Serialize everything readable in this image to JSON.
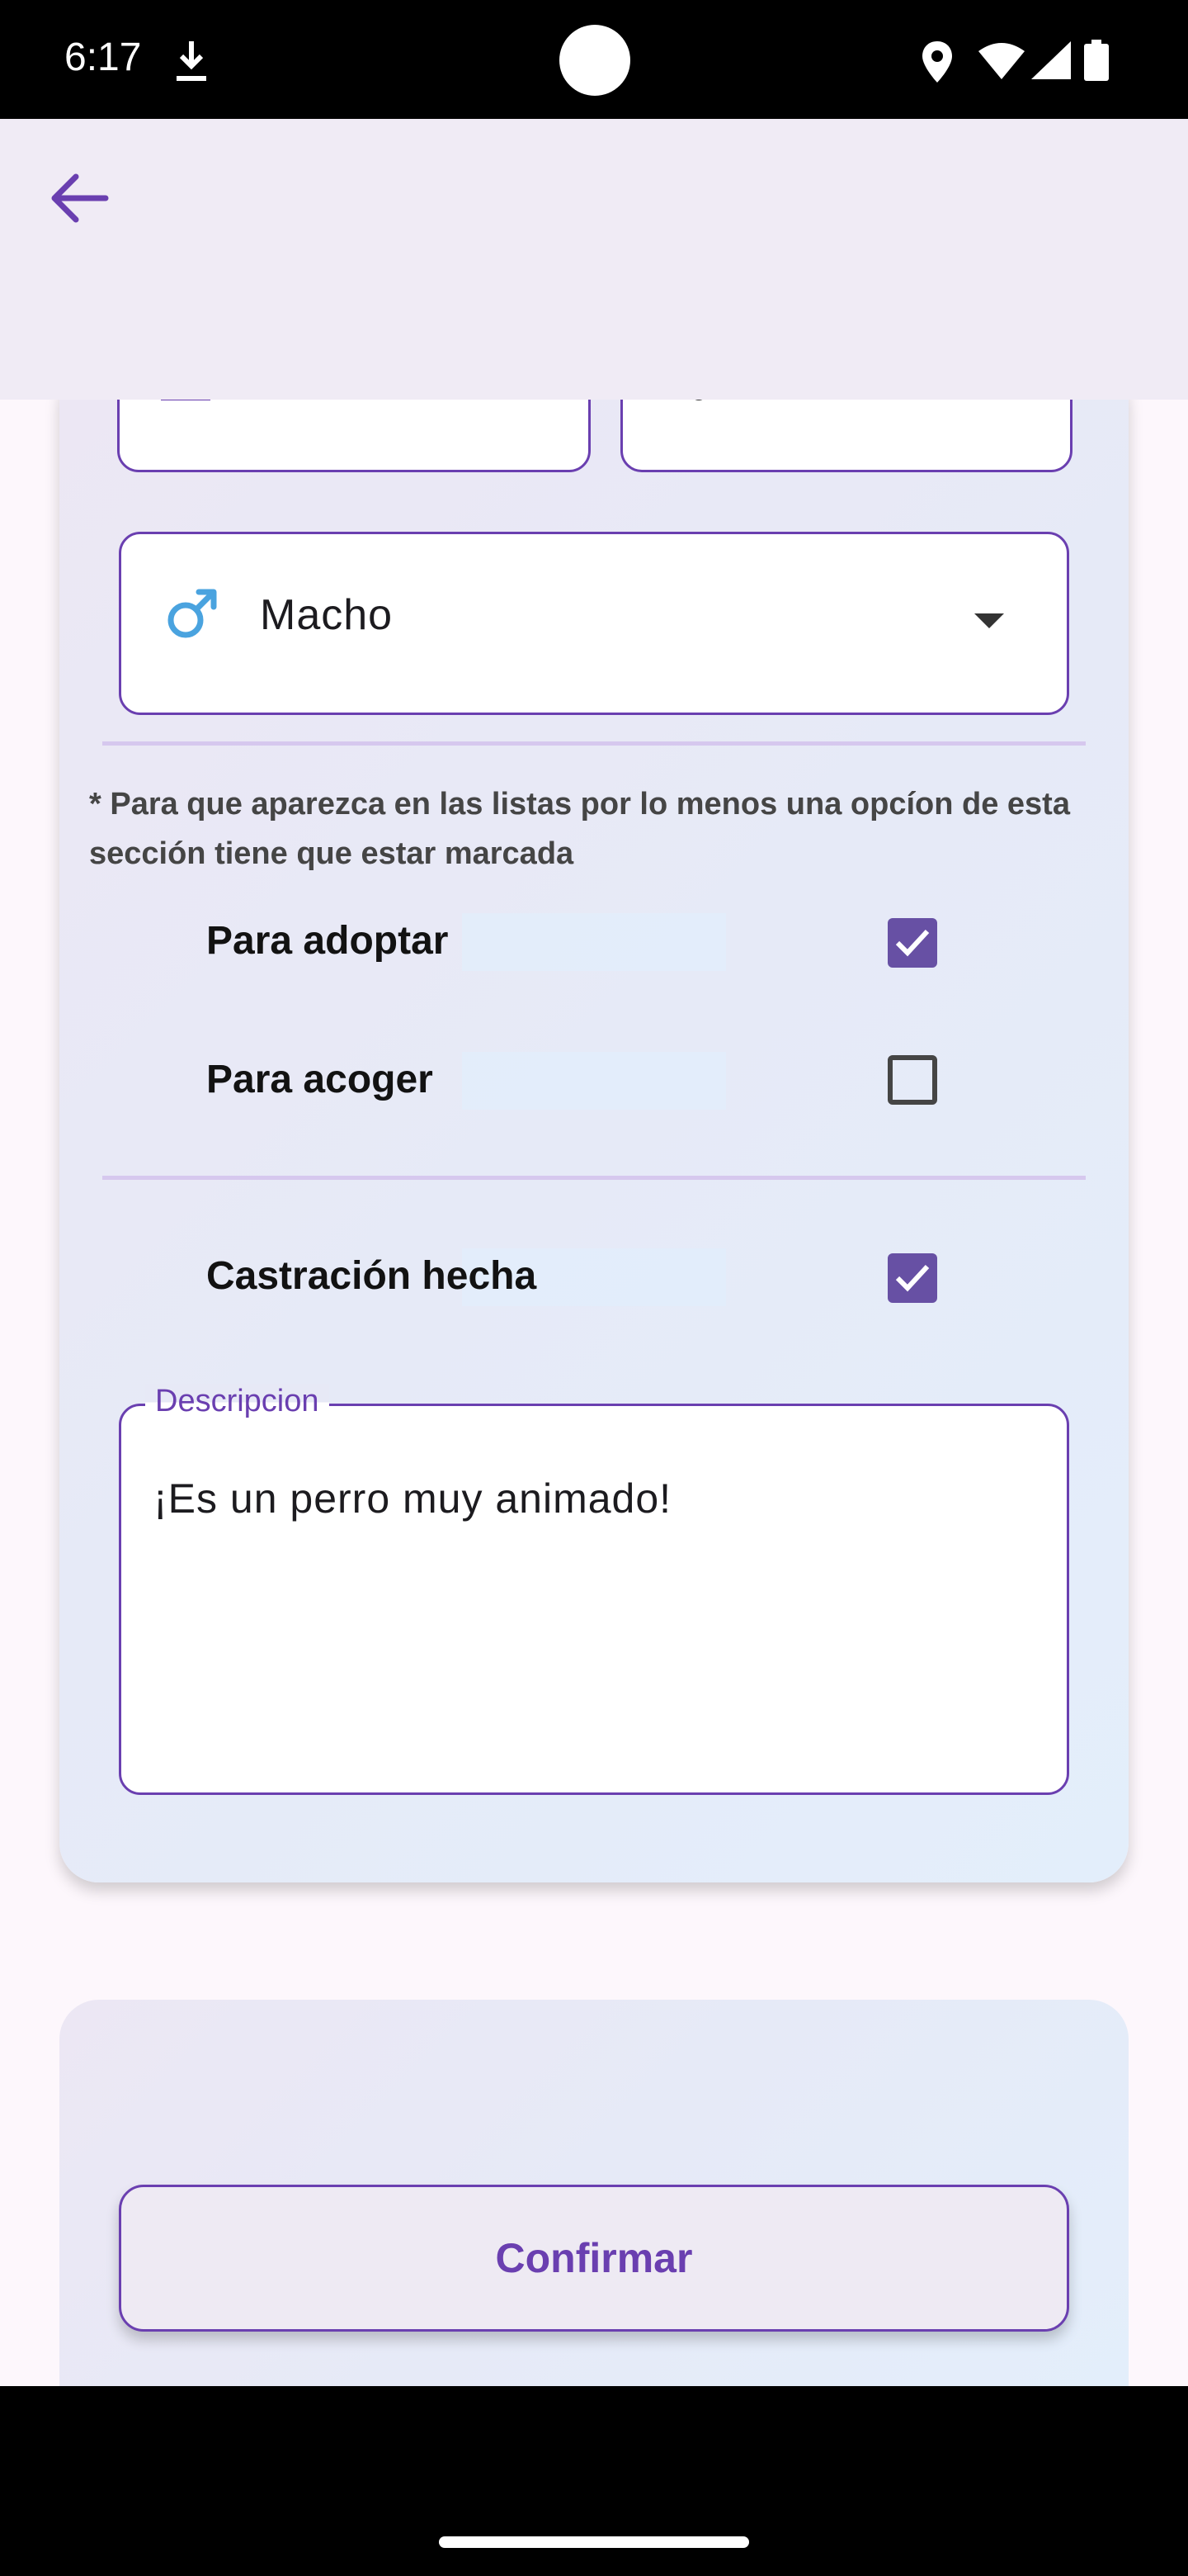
{
  "status_bar": {
    "time": "6:17",
    "icons": [
      "download-icon",
      "location-icon",
      "wifi-icon",
      "signal-icon",
      "battery-icon"
    ]
  },
  "app_bar": {
    "back_icon": "arrow-back-icon"
  },
  "form": {
    "gender_dropdown": {
      "icon": "male-icon",
      "value": "Macho"
    },
    "visibility_note": "* Para que aparezca en las listas por lo menos una opcíon de esta sección tiene que estar marcada",
    "options": [
      {
        "label": "Para adoptar",
        "checked": true
      },
      {
        "label": "Para acoger",
        "checked": false
      }
    ],
    "castration": {
      "label": "Castración hecha",
      "checked": true
    },
    "description": {
      "label": "Descripcion",
      "value": "¡Es un perro muy animado!"
    }
  },
  "confirm_button": {
    "label": "Confirmar"
  },
  "colors": {
    "accent": "#6a3fb0",
    "checkbox": "#6750a4",
    "male_icon": "#4aa3df",
    "app_bar": "#f0ebf5"
  }
}
